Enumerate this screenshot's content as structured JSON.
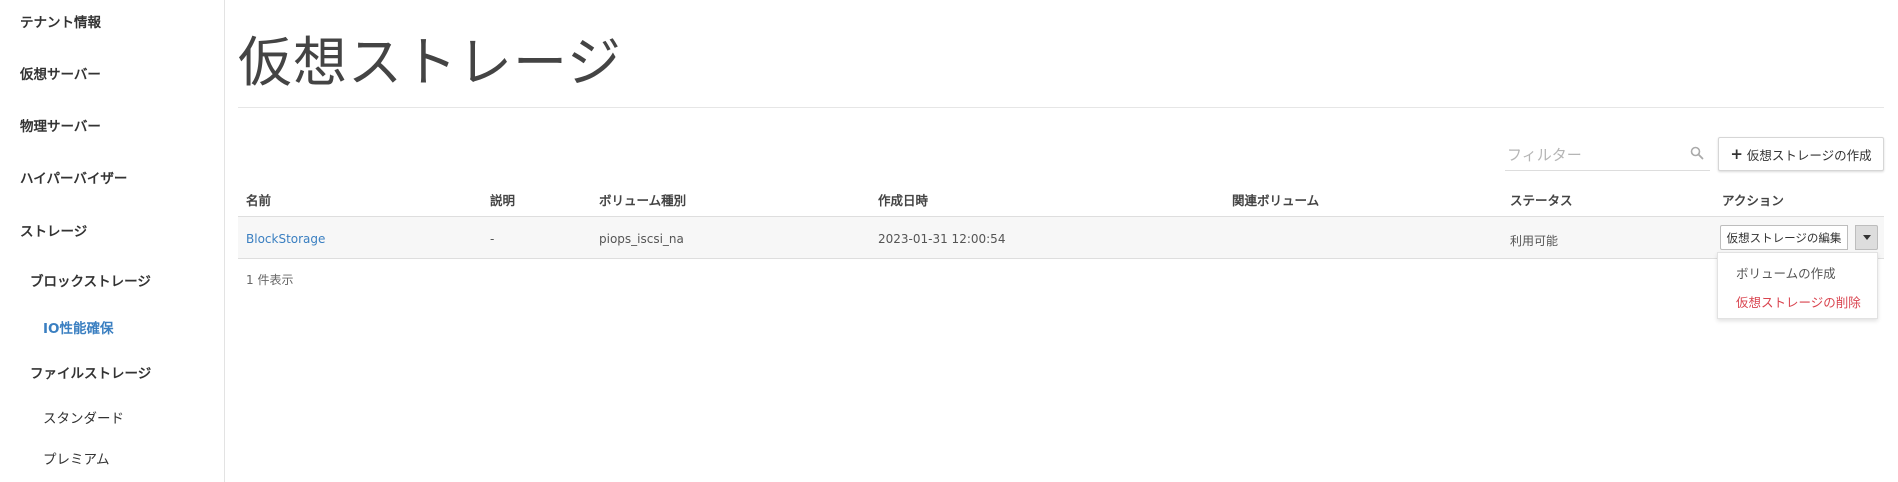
{
  "sidebar": {
    "items": [
      {
        "label": "テナント情報"
      },
      {
        "label": "仮想サーバー"
      },
      {
        "label": "物理サーバー"
      },
      {
        "label": "ハイパーバイザー"
      },
      {
        "label": "ストレージ"
      },
      {
        "label": "ブロックストレージ"
      },
      {
        "label": "IO性能確保"
      },
      {
        "label": "ファイルストレージ"
      },
      {
        "label": "スタンダード"
      },
      {
        "label": "プレミアム"
      }
    ],
    "active_color": "#3a7fc1"
  },
  "main": {
    "title": "仮想ストレージ",
    "filter": {
      "placeholder": "フィルター",
      "icon": "search-icon"
    },
    "create_button": {
      "icon": "plus-icon",
      "label": "仮想ストレージの作成"
    },
    "table": {
      "columns": [
        "名前",
        "説明",
        "ボリューム種別",
        "作成日時",
        "関連ボリューム",
        "ステータス",
        "アクション"
      ],
      "rows": [
        {
          "name": "BlockStorage",
          "description": "-",
          "volume_type": "piops_iscsi_na",
          "created_at": "2023-01-31 12:00:54",
          "related_volumes": "",
          "status": "利用可能",
          "action_label": "仮想ストレージの編集"
        }
      ],
      "footer": "1 件表示"
    },
    "action_menu": {
      "items": [
        {
          "label": "ボリュームの作成"
        },
        {
          "label": "仮想ストレージの削除"
        }
      ],
      "danger_color": "#d9434e"
    }
  }
}
